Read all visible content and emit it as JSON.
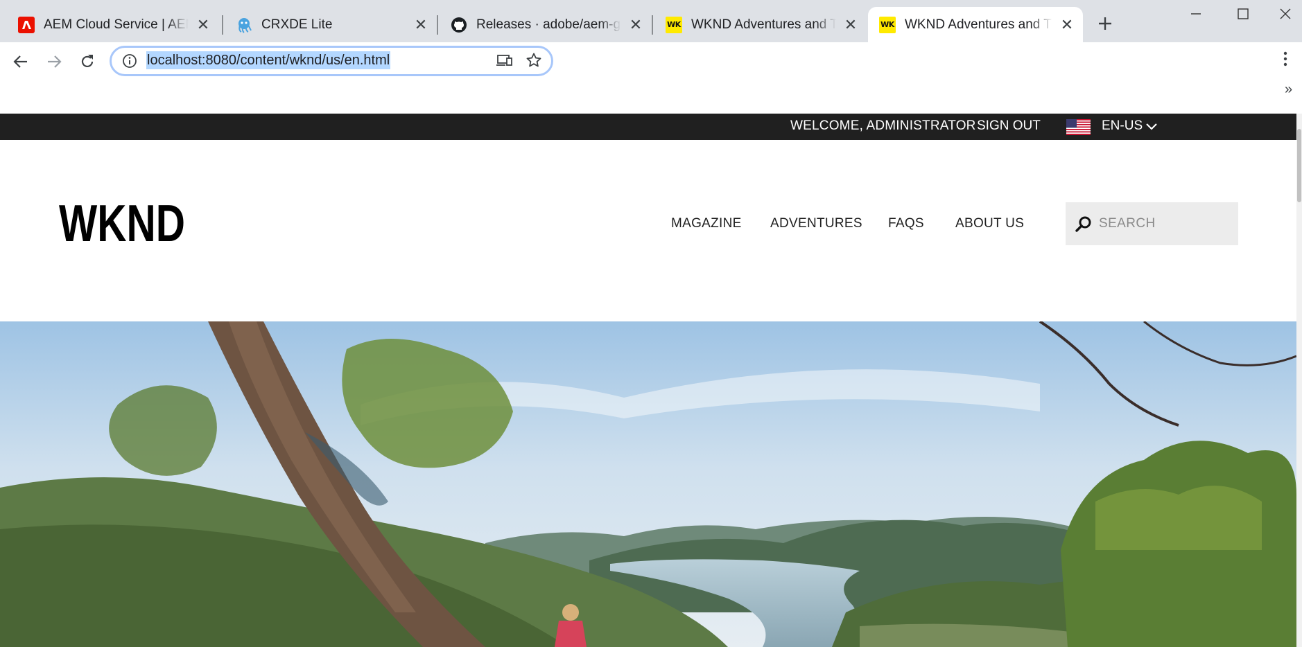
{
  "browser": {
    "tabs": [
      {
        "title": "AEM Cloud Service | AEM C",
        "favicon": "adobe-icon"
      },
      {
        "title": "CRXDE Lite",
        "favicon": "crxde-icon"
      },
      {
        "title": "Releases · adobe/aem-guid",
        "favicon": "github-icon"
      },
      {
        "title": "WKND Adventures and Tra",
        "favicon": "wknd-icon"
      },
      {
        "title": "WKND Adventures and Tra",
        "favicon": "wknd-icon",
        "active": true
      }
    ],
    "wknd_favicon_text": "WK",
    "address": "localhost:8080/content/wknd/us/en.html",
    "overflow_chevron": "»"
  },
  "site": {
    "utility_bar": {
      "welcome": "WELCOME, ADMINISTRATOR",
      "sign_out": "SIGN OUT",
      "language": "EN-US"
    },
    "logo": "WKND",
    "nav": [
      "MAGAZINE",
      "ADVENTURES",
      "FAQS",
      "ABOUT US"
    ],
    "search_placeholder": "SEARCH"
  },
  "colors": {
    "tabstrip": "#dee1e6",
    "utility_bar": "#202020",
    "search_bg": "#ececec",
    "wknd_yellow": "#ffea00",
    "adobe_red": "#eb1000"
  }
}
